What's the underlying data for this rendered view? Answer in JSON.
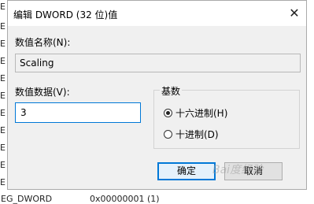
{
  "dialog": {
    "title": "编辑 DWORD (32 位)值",
    "close_icon": "✕",
    "value_name_label": "数值名称(N):",
    "value_name": "Scaling",
    "value_data_label": "数值数据(V):",
    "value_data": "3",
    "base_group_title": "基数",
    "base_options": [
      {
        "label": "十六进制(H)",
        "selected": true
      },
      {
        "label": "十进制(D)",
        "selected": false
      }
    ],
    "ok_label": "确定",
    "cancel_label": "取消"
  },
  "background": {
    "row_letters": [
      "E",
      "E",
      "E",
      "E",
      "E",
      "E",
      "E",
      "E",
      "E",
      "E",
      "E",
      "E",
      "E",
      "E",
      "E",
      "E",
      "E",
      "E",
      "E",
      "E"
    ],
    "bottom_row": {
      "name": "EG_DWORD",
      "value": "0x00000001 (1)"
    }
  },
  "watermark": "Bai度经验"
}
